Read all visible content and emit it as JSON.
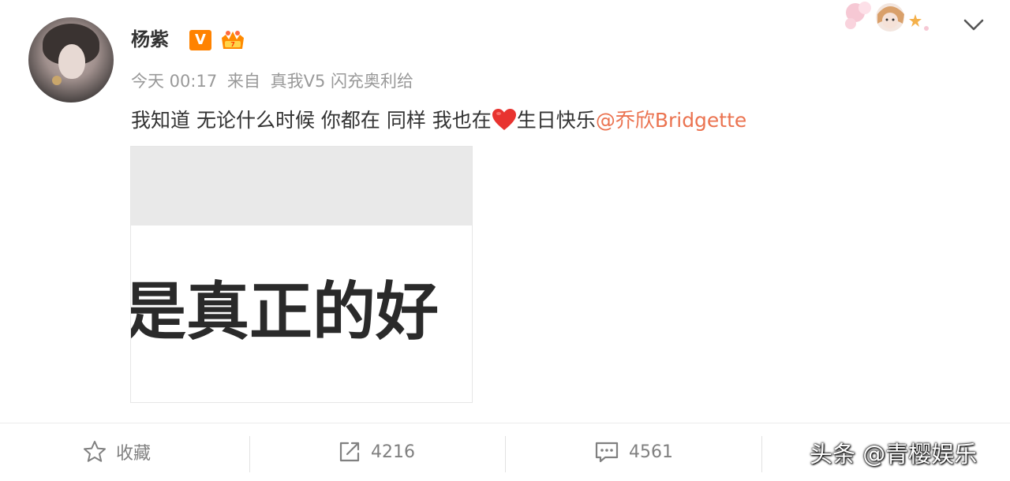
{
  "post": {
    "username": "杨紫",
    "verified_badge": "V",
    "vip_icon": "crown-vip-icon",
    "time": "今天 00:17",
    "source_prefix": "来自",
    "source_device": "真我V5 闪充奥利给",
    "text_main": "我知道 无论什么时候 你都在 同样 我也在",
    "text_after_heart": "生日快乐",
    "mention": "@乔欣Bridgette",
    "heart_icon": "red-heart-icon",
    "image_text": "是真正的好"
  },
  "actions": {
    "favorite_label": "收藏",
    "repost_count": "4216",
    "comment_count": "4561"
  },
  "watermark": "头条 @青樱娱乐",
  "colors": {
    "mention": "#eb7350",
    "verified": "#ff8200",
    "meta_text": "#999999",
    "heart": "#e8332f"
  }
}
